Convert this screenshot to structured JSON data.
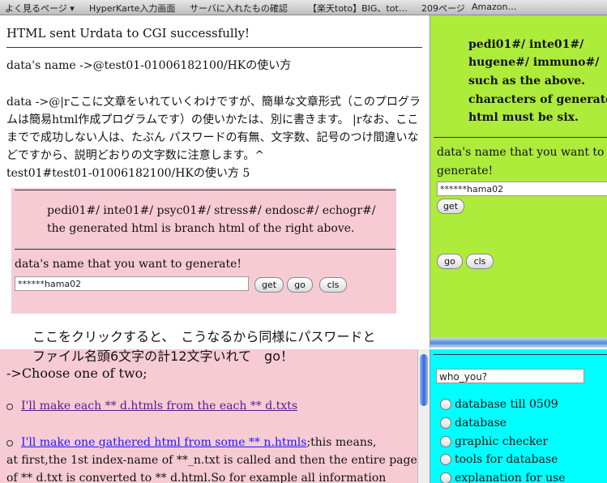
{
  "bookmarks": [
    {
      "label": "よく見るページ ▾"
    },
    {
      "label": "HyperKarte入力画面"
    },
    {
      "label": "サーバに入れたもの確認"
    },
    {
      "label": "【楽天toto】BIG、tot…"
    },
    {
      "label": "209ページ"
    },
    {
      "label": "Amazon…"
    }
  ],
  "main": {
    "status": "HTML sent Urdata to CGI successfully!",
    "dataname_line": "data's name ->@test01-01006182100/HKの使い方",
    "data_lines": [
      "data ->@|rここに文章をいれていくわけですが、簡単な文章形式（このプログラ",
      "ムは簡易html作成プログラムです）の使いかたは、別に書きます。 |rなお、ここ",
      "までで成功しない人は、たぶん パスワードの有無、文字数、記号のつけ間違いな",
      "どですから、説明どおりの文字数に注意します。^",
      "test01#test01-01006182100/HKの使い方 5"
    ],
    "box": {
      "line1": "pedi01#/ inte01#/ psyc01#/ stress#/ endosc#/ echogr#/",
      "line2": "the generated html is branch html of the right above.",
      "prompt": "data's name that you want to generate!",
      "input_value": "******hama02",
      "get_label": "get",
      "go_label": "go",
      "cls_label": "cls"
    },
    "annotation_line1": "ここをクリックすると、　こうなるから同様にパスワードと",
    "annotation_line2": "ファイル名頭6文字の計12文字いれて　go！"
  },
  "right": {
    "lines": [
      "pedi01#/ inte01#/",
      "hugene#/ immuno#/",
      "such as the above.",
      "characters of generated",
      "html must be six."
    ],
    "prompt_line1": "data's name that you want to",
    "prompt_line2": "generate!",
    "input_value": "******hama02",
    "get_label": "get",
    "go_label": "go",
    "cls_label": "cls"
  },
  "bottom_left": {
    "heading": "->Choose one of two;",
    "link1": "I'll make each ** d.htmls from the each ** d.txts",
    "link2": "I'll make one gathered html from some ** n.htmls",
    "link2_suffix": ";this means,",
    "para1": "at first,the 1st index-name of **_n.txt is called and then the entire page",
    "para2": "of ** d.txt is converted to ** d.html.So for example all information"
  },
  "bottom_right": {
    "input_value": "who_you?",
    "options": [
      {
        "label": "database till 0509"
      },
      {
        "label": "database"
      },
      {
        "label": "graphic checker"
      },
      {
        "label": "tools for database"
      },
      {
        "label": "explanation for use"
      }
    ]
  }
}
